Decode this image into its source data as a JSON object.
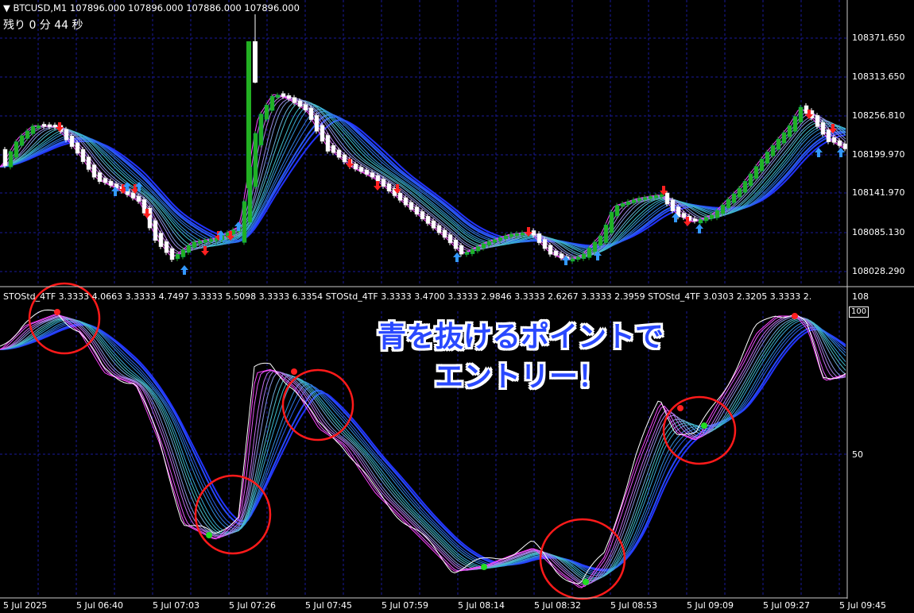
{
  "window": {
    "symbol_header": "▼ BTCUSD,M1  107896.000 107896.000 107886.000 107896.000",
    "countdown": "残り 0 分 44 秒"
  },
  "price_axis": {
    "labels": [
      "108371.650",
      "108313.650",
      "108256.810",
      "108199.970",
      "108141.970",
      "108085.130",
      "108028.290"
    ]
  },
  "indicator": {
    "header": "STOStd_4TF 3.3333 4.0663 3.3333 4.7497 3.3333 5.5098 3.3333 6.3354  STOStd_4TF 3.3333 3.4700 3.3333 2.9846 3.3333 2.6267 3.3333 2.3959  STOStd_4TF 3.0303 2.3205 3.3333 2.",
    "scale_top": "108",
    "scale_box": "100",
    "scale_mid": "50"
  },
  "time_axis": {
    "labels": [
      "5 Jul 2025",
      "5 Jul 06:40",
      "5 Jul 07:03",
      "5 Jul 07:26",
      "5 Jul 07:45",
      "5 Jul 07:59",
      "5 Jul 08:14",
      "5 Jul 08:32",
      "5 Jul 08:53",
      "5 Jul 09:09",
      "5 Jul 09:27",
      "5 Jul 09:45"
    ]
  },
  "annotation": {
    "line1": "青を抜けるポイントで",
    "line2": "エントリー！"
  },
  "colors": {
    "background": "#000000",
    "grid": "#1a1a9a",
    "bull_candle": "#22b022",
    "bear_candle": "#ffffff",
    "buy_arrow": "#3399ff",
    "sell_arrow": "#ff2020",
    "ribbon_fast": "#ff44ff",
    "ribbon_mid": "#40c8c8",
    "ribbon_slow": "#2233ff",
    "highlight_circle": "#ff1a1a",
    "annotation_text": "#2a49ff"
  },
  "markers": {
    "buy": "up-arrow-icon",
    "sell": "down-arrow-icon"
  }
}
